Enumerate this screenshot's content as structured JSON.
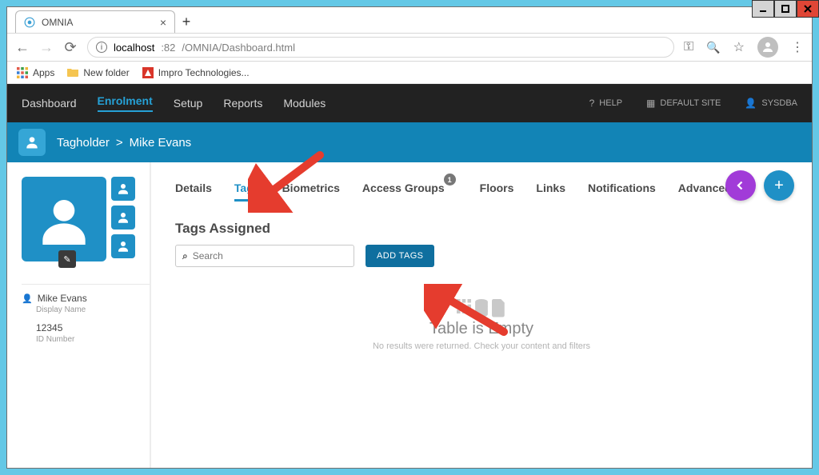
{
  "window": {
    "title": "OMNIA"
  },
  "browser": {
    "tab_title": "OMNIA",
    "url_host": "localhost",
    "url_port": ":82",
    "url_path": "/OMNIA/Dashboard.html"
  },
  "bookmarks": {
    "apps": "Apps",
    "newfolder": "New folder",
    "impro": "Impro Technologies..."
  },
  "nav": {
    "items": [
      "Dashboard",
      "Enrolment",
      "Setup",
      "Reports",
      "Modules"
    ],
    "active_index": 1,
    "help": "HELP",
    "site": "DEFAULT SITE",
    "user": "SYSDBA"
  },
  "breadcrumb": {
    "root": "Tagholder",
    "sep": ">",
    "current": "Mike Evans"
  },
  "profile": {
    "display_name": "Mike Evans",
    "display_name_label": "Display Name",
    "id_number": "12345",
    "id_number_label": "ID Number"
  },
  "tabs": {
    "items": [
      "Details",
      "Tags",
      "Biometrics",
      "Access Groups",
      "Floors",
      "Links",
      "Notifications",
      "Advanced"
    ],
    "active_index": 1,
    "access_groups_badge": "1"
  },
  "tags": {
    "section_title": "Tags Assigned",
    "search_placeholder": "Search",
    "add_button": "ADD TAGS"
  },
  "empty": {
    "title": "Table is Empty",
    "subtitle": "No results were returned. Check your content and filters"
  }
}
